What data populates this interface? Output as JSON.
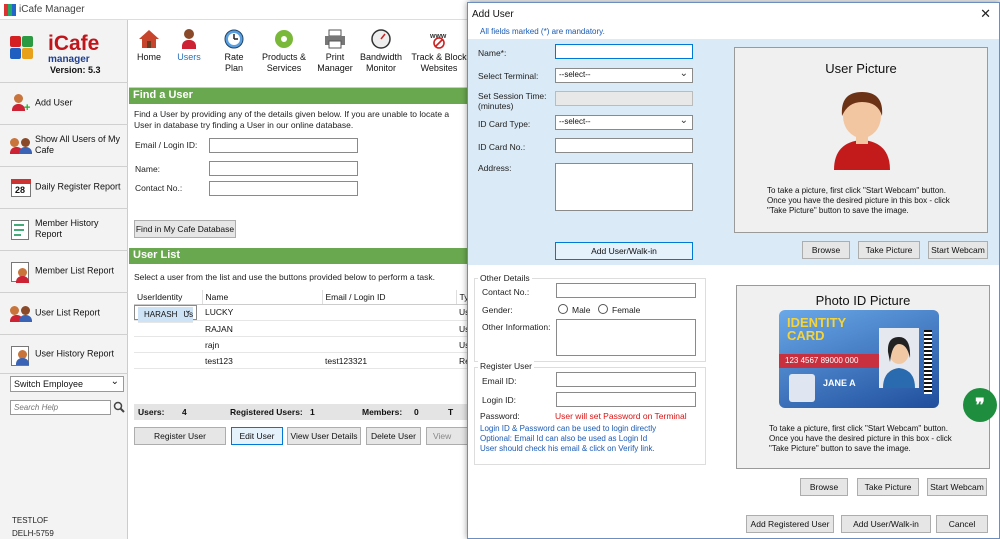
{
  "window": {
    "title": "iCafe Manager"
  },
  "logo": {
    "brand_a": "iCafe",
    "brand_b": "manager",
    "version": "Version: 5.3"
  },
  "sidebar": {
    "items": [
      {
        "label": "Add User"
      },
      {
        "label": "Show All Users of My Cafe"
      },
      {
        "label": "Daily Register Report"
      },
      {
        "label": "Member History Report"
      },
      {
        "label": "Member List Report"
      },
      {
        "label": "User List Report"
      },
      {
        "label": "User History Report"
      }
    ],
    "switch_employee": "Switch Employee",
    "search_placeholder": "Search Help",
    "footer_name": "TESTLOF",
    "footer_id": "DELH-5759"
  },
  "toolbar": {
    "items": [
      {
        "label": "Home"
      },
      {
        "label": "Users"
      },
      {
        "label": "Rate Plan"
      },
      {
        "label": "Products & Services"
      },
      {
        "label": "Print Manager"
      },
      {
        "label": "Bandwidth Monitor"
      },
      {
        "label": "Track & Block Websites"
      }
    ]
  },
  "find_user": {
    "title": "Find a User",
    "description": "Find a User by providing any of the details given below. If you are unable to locate a User in database try finding a User in our online database.",
    "email_label": "Email / Login ID:",
    "name_label": "Name:",
    "contact_label": "Contact No.:",
    "find_button": "Find in My Cafe Database"
  },
  "user_list": {
    "title": "User List",
    "instruction": "Select a user from the list and use the buttons provided below to perform a task.",
    "columns": [
      "UserIdentity",
      "Name",
      "Email / Login ID",
      "Ty"
    ],
    "rows": [
      {
        "identity": "",
        "name": "HARASH",
        "email": "",
        "type": "Us"
      },
      {
        "identity": "",
        "name": "LUCKY",
        "email": "",
        "type": "Us"
      },
      {
        "identity": "",
        "name": "RAJAN",
        "email": "",
        "type": "Us"
      },
      {
        "identity": "",
        "name": "rajn",
        "email": "",
        "type": "Us"
      },
      {
        "identity": "",
        "name": "test123",
        "email": "test123321",
        "type": "Re"
      }
    ],
    "stats": {
      "users_label": "Users:",
      "users": "4",
      "registered_label": "Registered Users:",
      "registered": "1",
      "members_label": "Members:",
      "members": "0",
      "total_label": "T"
    },
    "buttons": [
      "Register User",
      "Edit User",
      "View User Details",
      "Delete User",
      "View Mem"
    ]
  },
  "dialog": {
    "title": "Add User",
    "mandatory_note": "All fields marked (*) are mandatory.",
    "name_label": "Name*:",
    "terminal_label": "Select Terminal:",
    "terminal_value": "--select--",
    "session_label": "Set Session Time: (minutes)",
    "id_type_label": "ID Card Type:",
    "id_type_value": "--select--",
    "id_no_label": "ID Card No.:",
    "address_label": "Address:",
    "add_walkin_button": "Add User/Walk-in",
    "other_details": "Other Details",
    "contact_label": "Contact No.:",
    "gender_label": "Gender:",
    "male": "Male",
    "female": "Female",
    "other_info_label": "Other Information:",
    "register_user": "Register User",
    "email_label": "Email ID:",
    "login_label": "Login ID:",
    "password_label": "Password:",
    "password_note": "User will set Password on Terminal",
    "hints": [
      "Login ID & Password can be used to login directly",
      "Optional: Email Id can also be used as Login Id",
      "User should check his email & click on Verify link."
    ],
    "user_picture": {
      "title": "User Picture",
      "text": "To take a picture, first click \"Start Webcam\" button. Once you have the desired picture in this box - click \"Take Picture\" button to save the image.",
      "buttons": [
        "Browse",
        "Take Picture",
        "Start Webcam"
      ]
    },
    "photo_id": {
      "title": "Photo ID Picture",
      "card_title": "IDENTITY CARD",
      "card_number": "123 4567 89000 000",
      "card_name": "JANE A",
      "text": "To take a picture, first click \"Start Webcam\" button. Once you have the desired picture in this box - click \"Take Picture\" button to save the image.",
      "buttons": [
        "Browse",
        "Take Picture",
        "Start Webcam"
      ]
    },
    "footer_buttons": [
      "Add Registered User",
      "Add User/Walk-in",
      "Cancel"
    ]
  },
  "colors": {
    "green_header": "#6aa84f",
    "selected_row": "#cfe3f7",
    "dialog_band": "#daeaf6",
    "brand_red": "#c0151b",
    "brand_blue": "#1f3f8f",
    "fab": "#1e8e3e"
  }
}
